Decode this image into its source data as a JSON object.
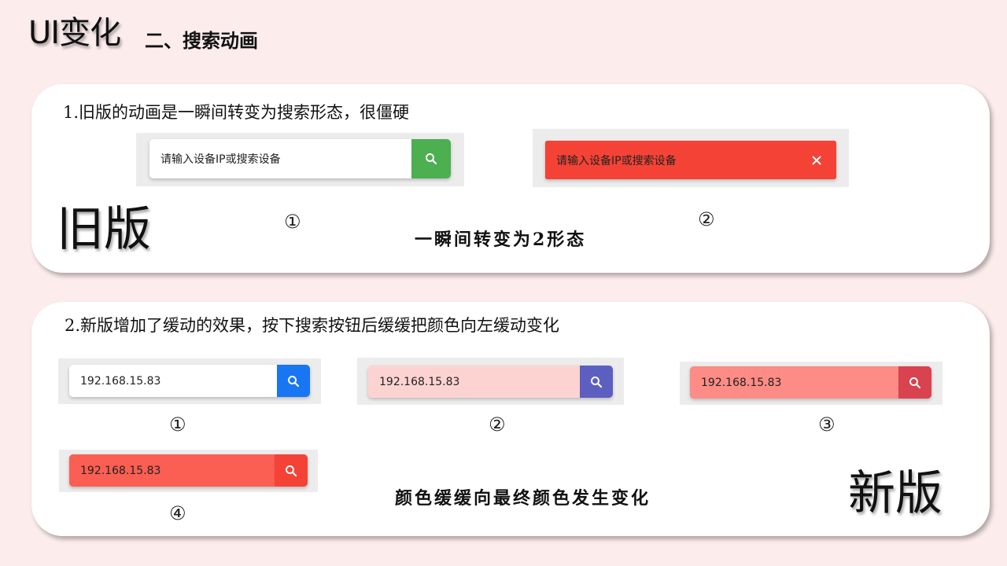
{
  "header": {
    "title": "UI变化",
    "subtitle": "二、搜索动画"
  },
  "old_section": {
    "note": "1.旧版的动画是一瞬间转变为搜索形态，很僵硬",
    "label": "旧版",
    "caption": "一瞬间转变为2形态",
    "state1": {
      "placeholder": "请输入设备IP或搜索设备",
      "marker": "①",
      "field_color": "#ffffff",
      "button_color": "#4caf50",
      "icon": "search-icon"
    },
    "state2": {
      "placeholder": "请输入设备IP或搜索设备",
      "marker": "②",
      "field_color": "#f44336",
      "button_color": "#f44336",
      "icon": "close-icon"
    }
  },
  "new_section": {
    "note": "2.新版增加了缓动的效果，按下搜索按钮后缓缓把颜色向左缓动变化",
    "label": "新版",
    "caption": "颜色缓缓向最终颜色发生变化",
    "states": [
      {
        "value": "192.168.15.83",
        "marker": "①",
        "field_color": "#ffffff",
        "button_color": "#1976f2",
        "icon": "search-icon"
      },
      {
        "value": "192.168.15.83",
        "marker": "②",
        "field_color": "#fdd3d1",
        "button_color": "#5c5fc0",
        "icon": "search-icon"
      },
      {
        "value": "192.168.15.83",
        "marker": "③",
        "field_color": "#fc8c85",
        "button_color": "#d9424f",
        "icon": "search-icon"
      },
      {
        "value": "192.168.15.83",
        "marker": "④",
        "field_color": "#fb5e52",
        "button_color": "#f44336",
        "icon": "search-icon"
      }
    ]
  }
}
